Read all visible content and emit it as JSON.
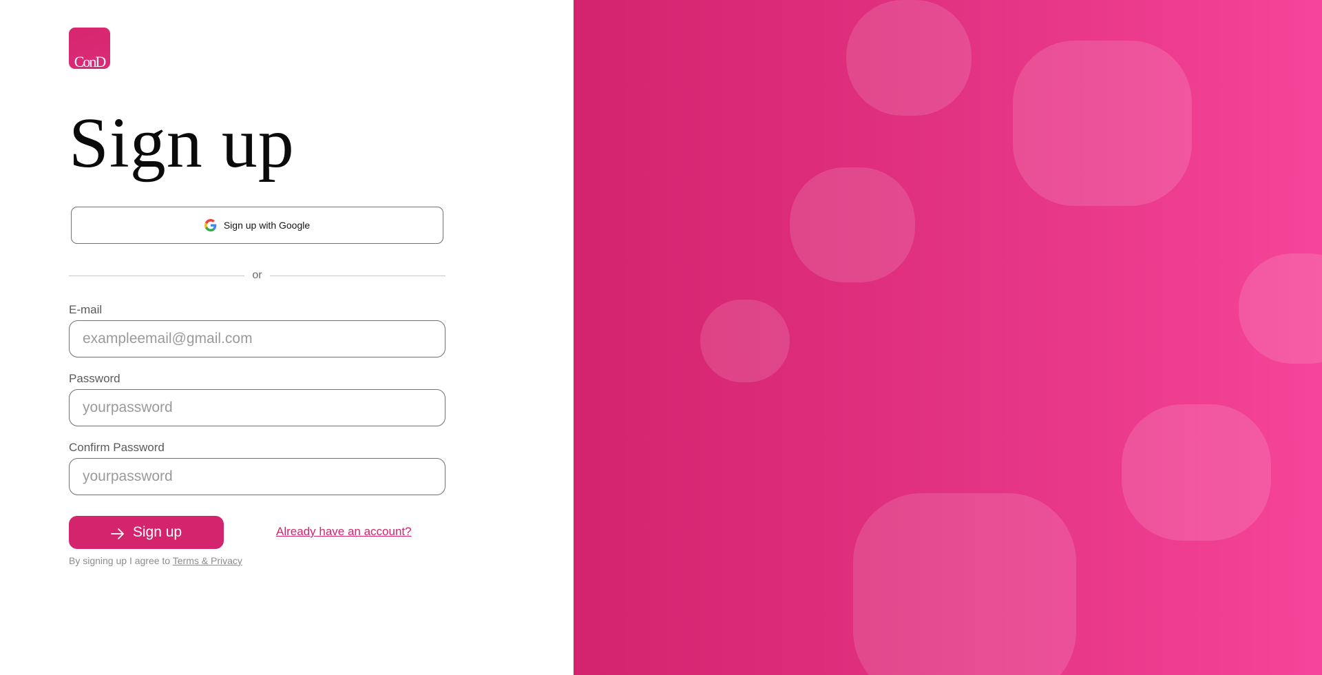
{
  "brand": {
    "logo_text": "ConD",
    "accent_color": "#d4246e"
  },
  "header": {
    "title": "Sign up"
  },
  "google": {
    "label": "Sign up with Google",
    "icon": "google-icon"
  },
  "divider": {
    "text": "or"
  },
  "form": {
    "email": {
      "label": "E-mail",
      "value": "",
      "placeholder": "exampleemail@gmail.com"
    },
    "password": {
      "label": "Password",
      "value": "",
      "placeholder": "yourpassword"
    },
    "confirm": {
      "label": "Confirm Password",
      "value": "",
      "placeholder": "yourpassword"
    }
  },
  "actions": {
    "signup_label": "Sign up",
    "signup_icon": "arrow-right-icon",
    "login_link": "Already have an account?"
  },
  "terms": {
    "prefix": "By signing up I agree to",
    "link": "Terms & Privacy"
  },
  "decor": {
    "panel_gradient": [
      "#d4236e",
      "#f6449a"
    ]
  }
}
